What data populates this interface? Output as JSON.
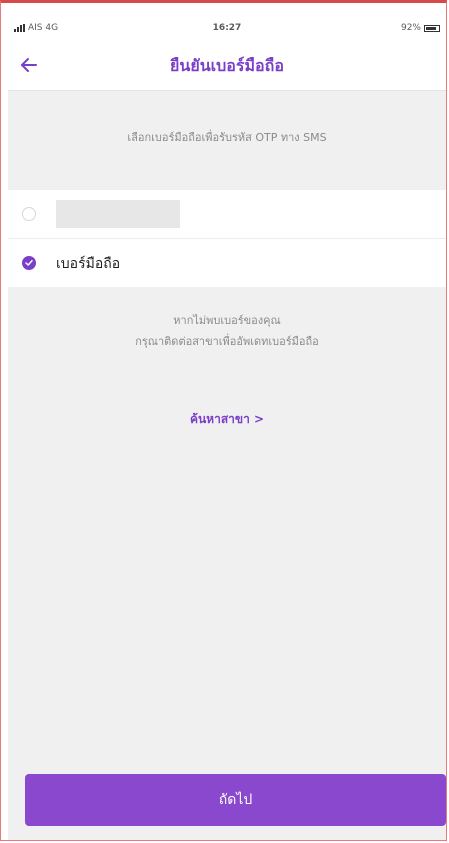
{
  "status_bar": {
    "carrier": "AIS 4G",
    "time": "16:27",
    "battery": "92%"
  },
  "header": {
    "title": "ยืนยันเบอร์มือถือ",
    "back_icon": "arrow-left-icon"
  },
  "instruction": "เลือกเบอร์มือถือเพื่อรับรหัส OTP ทาง SMS",
  "options": [
    {
      "label": "",
      "selected": false,
      "masked": true
    },
    {
      "label": "เบอร์มือถือ",
      "selected": true,
      "masked": false
    }
  ],
  "notice": {
    "line1": "หากไม่พบเบอร์ของคุณ",
    "line2": "กรุณาติดต่อสาขาเพื่ออัพเดทเบอร์มือถือ"
  },
  "contact_link": "ค้นหาสาขา >",
  "next_button": "ถัดไป",
  "colors": {
    "accent": "#7a3fc8",
    "button": "#8a48cf",
    "background": "#f0f0f0"
  }
}
